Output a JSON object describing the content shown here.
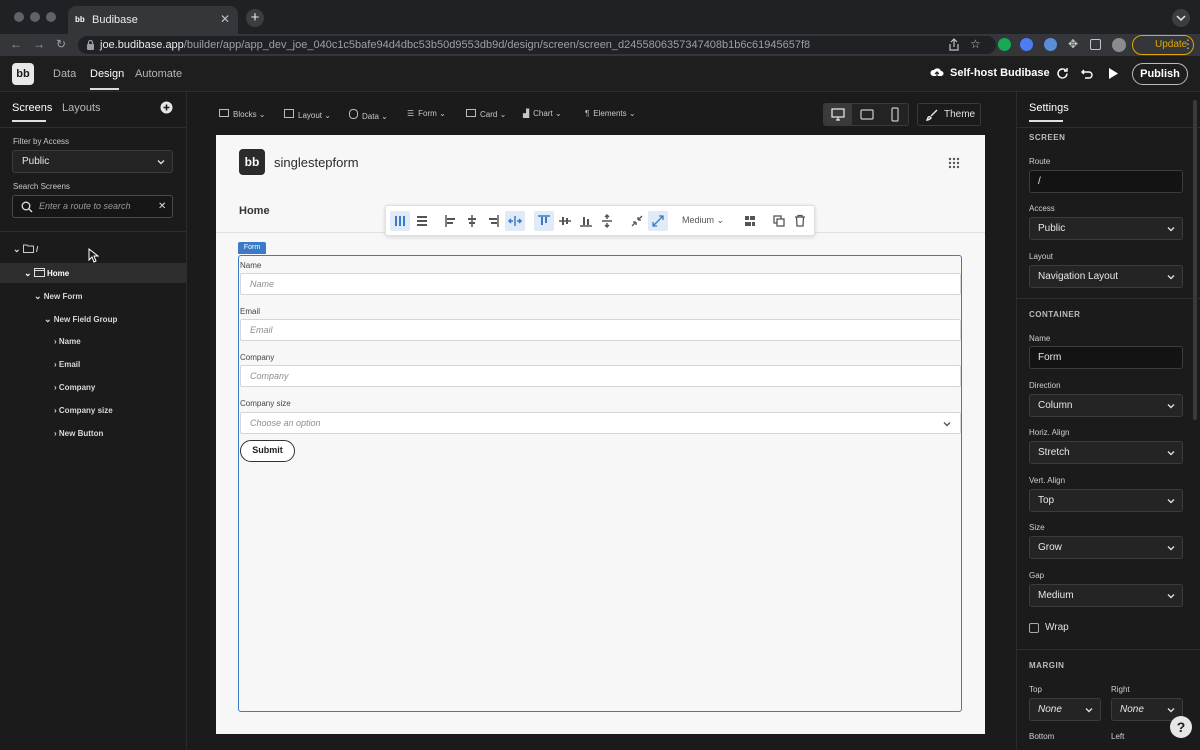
{
  "browser": {
    "tab_title": "Budibase",
    "tab_favicon": "bb",
    "url_host": "joe.budibase.app",
    "url_path": "/builder/app/app_dev_joe_040c1c5bafe94d4dbc53b50d9553db9d/design/screen/screen_d2455806357347408b1b6c61945657f8",
    "update_label": "Update"
  },
  "app_header": {
    "logo": "bb",
    "nav": [
      "Data",
      "Design",
      "Automate"
    ],
    "active_nav": "Design",
    "selfhost_label": "Self-host Budibase",
    "publish_label": "Publish"
  },
  "left_panel": {
    "tabs": [
      "Screens",
      "Layouts"
    ],
    "filter_label": "Filter by Access",
    "filter_value": "Public",
    "search_label": "Search Screens",
    "search_placeholder": "Enter a route to search",
    "tree": [
      {
        "label": "/",
        "level": 0
      },
      {
        "label": "Home",
        "level": 1,
        "selected": true
      },
      {
        "label": "New Form",
        "level": 2
      },
      {
        "label": "New Field Group",
        "level": 3
      },
      {
        "label": "Name",
        "level": 4
      },
      {
        "label": "Email",
        "level": 4
      },
      {
        "label": "Company",
        "level": 4
      },
      {
        "label": "Company size",
        "level": 4
      },
      {
        "label": "New Button",
        "level": 4
      }
    ]
  },
  "toolbar": {
    "items": [
      "Blocks",
      "Layout",
      "Data",
      "Form",
      "Card",
      "Chart",
      "Elements"
    ],
    "theme_label": "Theme"
  },
  "preview": {
    "app_logo": "bb",
    "app_name": "singlestepform",
    "nav_home": "Home",
    "form_tag": "Form",
    "fields": [
      {
        "label": "Name",
        "placeholder": "Name"
      },
      {
        "label": "Email",
        "placeholder": "Email"
      },
      {
        "label": "Company",
        "placeholder": "Company"
      },
      {
        "label": "Company size",
        "placeholder": "Choose an option"
      }
    ],
    "submit_label": "Submit",
    "floating_toolbar": {
      "size_value": "Medium"
    }
  },
  "settings": {
    "title": "Settings",
    "screen_header": "SCREEN",
    "route_label": "Route",
    "route_value": "/",
    "access_label": "Access",
    "access_value": "Public",
    "layout_label": "Layout",
    "layout_value": "Navigation Layout",
    "container_header": "CONTAINER",
    "name_label": "Name",
    "name_value": "Form",
    "direction_label": "Direction",
    "direction_value": "Column",
    "halign_label": "Horiz. Align",
    "halign_value": "Stretch",
    "valign_label": "Vert. Align",
    "valign_value": "Top",
    "size_label": "Size",
    "size_value": "Grow",
    "gap_label": "Gap",
    "gap_value": "Medium",
    "wrap_label": "Wrap",
    "margin_header": "MARGIN",
    "top_label": "Top",
    "top_value": "None",
    "right_label": "Right",
    "right_value": "None",
    "bottom_label": "Bottom",
    "left_label": "Left"
  },
  "colors": {
    "accent_blue": "#3b79c9",
    "update_amber": "#e0a800"
  }
}
